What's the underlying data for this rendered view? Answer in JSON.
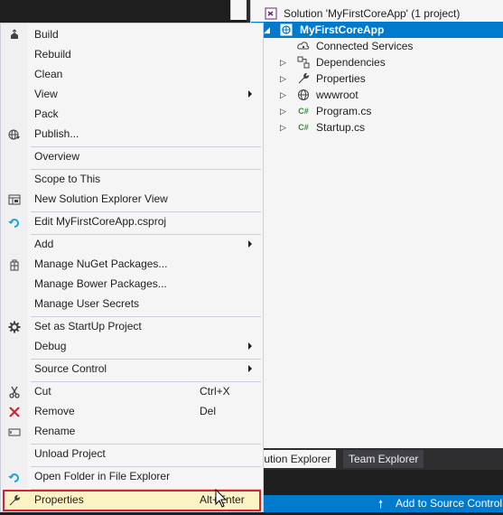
{
  "solution_explorer": {
    "solution_label": "Solution 'MyFirstCoreApp' (1 project)",
    "project_label": "MyFirstCoreApp",
    "items": [
      {
        "label": "Connected Services",
        "icon": "connected-services-icon"
      },
      {
        "label": "Dependencies",
        "icon": "dependencies-icon"
      },
      {
        "label": "Properties",
        "icon": "wrench-icon"
      },
      {
        "label": "wwwroot",
        "icon": "globe-icon"
      },
      {
        "label": "Program.cs",
        "icon": "csharp-file-icon"
      },
      {
        "label": "Startup.cs",
        "icon": "csharp-file-icon"
      }
    ],
    "tabs": {
      "solution_explorer": "olution Explorer",
      "team_explorer": "Team Explorer"
    }
  },
  "status_bar": {
    "text": "Add to Source Control"
  },
  "context_menu": {
    "items": [
      {
        "label": "Build",
        "icon": "build-icon"
      },
      {
        "label": "Rebuild"
      },
      {
        "label": "Clean"
      },
      {
        "label": "View",
        "submenu": true
      },
      {
        "label": "Pack"
      },
      {
        "label": "Publish...",
        "icon": "publish-globe-icon"
      },
      {
        "label": "Overview"
      },
      {
        "label": "Scope to This"
      },
      {
        "label": "New Solution Explorer View",
        "icon": "new-view-icon"
      },
      {
        "label": "Edit MyFirstCoreApp.csproj",
        "icon": "refresh-arrow-icon"
      },
      {
        "label": "Add",
        "submenu": true
      },
      {
        "label": "Manage NuGet Packages...",
        "icon": "nuget-icon"
      },
      {
        "label": "Manage Bower Packages..."
      },
      {
        "label": "Manage User Secrets"
      },
      {
        "label": "Set as StartUp Project",
        "icon": "gear-icon"
      },
      {
        "label": "Debug",
        "submenu": true
      },
      {
        "label": "Source Control",
        "submenu": true
      },
      {
        "label": "Cut",
        "shortcut": "Ctrl+X",
        "icon": "scissors-icon"
      },
      {
        "label": "Remove",
        "shortcut": "Del",
        "icon": "remove-x-icon"
      },
      {
        "label": "Rename",
        "icon": "rename-icon"
      },
      {
        "label": "Unload Project"
      },
      {
        "label": "Open Folder in File Explorer",
        "icon": "refresh-arrow-icon"
      },
      {
        "label": "Properties",
        "shortcut": "Alt+Enter",
        "icon": "wrench-icon"
      }
    ]
  },
  "colors": {
    "accent": "#007acc",
    "highlight": "#fcf3c4",
    "highlight_border": "#d82132"
  }
}
